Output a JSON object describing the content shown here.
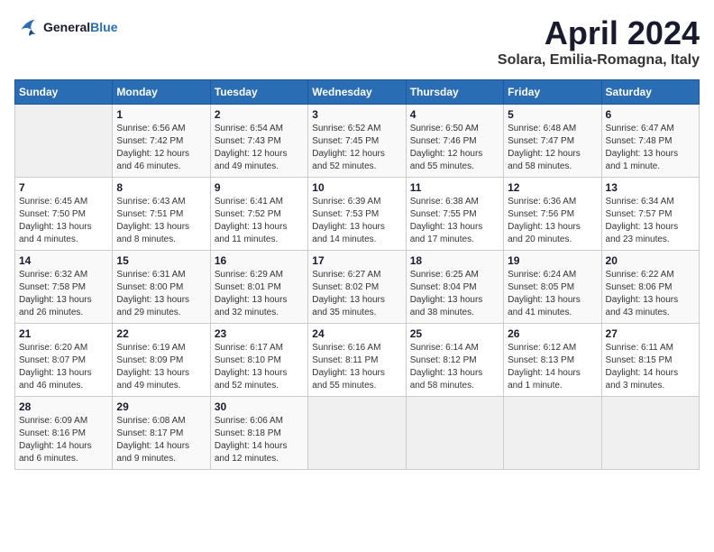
{
  "logo": {
    "line1": "General",
    "line2": "Blue"
  },
  "title": "April 2024",
  "location": "Solara, Emilia-Romagna, Italy",
  "headers": [
    "Sunday",
    "Monday",
    "Tuesday",
    "Wednesday",
    "Thursday",
    "Friday",
    "Saturday"
  ],
  "weeks": [
    [
      {
        "day": "",
        "info": ""
      },
      {
        "day": "1",
        "info": "Sunrise: 6:56 AM\nSunset: 7:42 PM\nDaylight: 12 hours\nand 46 minutes."
      },
      {
        "day": "2",
        "info": "Sunrise: 6:54 AM\nSunset: 7:43 PM\nDaylight: 12 hours\nand 49 minutes."
      },
      {
        "day": "3",
        "info": "Sunrise: 6:52 AM\nSunset: 7:45 PM\nDaylight: 12 hours\nand 52 minutes."
      },
      {
        "day": "4",
        "info": "Sunrise: 6:50 AM\nSunset: 7:46 PM\nDaylight: 12 hours\nand 55 minutes."
      },
      {
        "day": "5",
        "info": "Sunrise: 6:48 AM\nSunset: 7:47 PM\nDaylight: 12 hours\nand 58 minutes."
      },
      {
        "day": "6",
        "info": "Sunrise: 6:47 AM\nSunset: 7:48 PM\nDaylight: 13 hours\nand 1 minute."
      }
    ],
    [
      {
        "day": "7",
        "info": "Sunrise: 6:45 AM\nSunset: 7:50 PM\nDaylight: 13 hours\nand 4 minutes."
      },
      {
        "day": "8",
        "info": "Sunrise: 6:43 AM\nSunset: 7:51 PM\nDaylight: 13 hours\nand 8 minutes."
      },
      {
        "day": "9",
        "info": "Sunrise: 6:41 AM\nSunset: 7:52 PM\nDaylight: 13 hours\nand 11 minutes."
      },
      {
        "day": "10",
        "info": "Sunrise: 6:39 AM\nSunset: 7:53 PM\nDaylight: 13 hours\nand 14 minutes."
      },
      {
        "day": "11",
        "info": "Sunrise: 6:38 AM\nSunset: 7:55 PM\nDaylight: 13 hours\nand 17 minutes."
      },
      {
        "day": "12",
        "info": "Sunrise: 6:36 AM\nSunset: 7:56 PM\nDaylight: 13 hours\nand 20 minutes."
      },
      {
        "day": "13",
        "info": "Sunrise: 6:34 AM\nSunset: 7:57 PM\nDaylight: 13 hours\nand 23 minutes."
      }
    ],
    [
      {
        "day": "14",
        "info": "Sunrise: 6:32 AM\nSunset: 7:58 PM\nDaylight: 13 hours\nand 26 minutes."
      },
      {
        "day": "15",
        "info": "Sunrise: 6:31 AM\nSunset: 8:00 PM\nDaylight: 13 hours\nand 29 minutes."
      },
      {
        "day": "16",
        "info": "Sunrise: 6:29 AM\nSunset: 8:01 PM\nDaylight: 13 hours\nand 32 minutes."
      },
      {
        "day": "17",
        "info": "Sunrise: 6:27 AM\nSunset: 8:02 PM\nDaylight: 13 hours\nand 35 minutes."
      },
      {
        "day": "18",
        "info": "Sunrise: 6:25 AM\nSunset: 8:04 PM\nDaylight: 13 hours\nand 38 minutes."
      },
      {
        "day": "19",
        "info": "Sunrise: 6:24 AM\nSunset: 8:05 PM\nDaylight: 13 hours\nand 41 minutes."
      },
      {
        "day": "20",
        "info": "Sunrise: 6:22 AM\nSunset: 8:06 PM\nDaylight: 13 hours\nand 43 minutes."
      }
    ],
    [
      {
        "day": "21",
        "info": "Sunrise: 6:20 AM\nSunset: 8:07 PM\nDaylight: 13 hours\nand 46 minutes."
      },
      {
        "day": "22",
        "info": "Sunrise: 6:19 AM\nSunset: 8:09 PM\nDaylight: 13 hours\nand 49 minutes."
      },
      {
        "day": "23",
        "info": "Sunrise: 6:17 AM\nSunset: 8:10 PM\nDaylight: 13 hours\nand 52 minutes."
      },
      {
        "day": "24",
        "info": "Sunrise: 6:16 AM\nSunset: 8:11 PM\nDaylight: 13 hours\nand 55 minutes."
      },
      {
        "day": "25",
        "info": "Sunrise: 6:14 AM\nSunset: 8:12 PM\nDaylight: 13 hours\nand 58 minutes."
      },
      {
        "day": "26",
        "info": "Sunrise: 6:12 AM\nSunset: 8:13 PM\nDaylight: 14 hours\nand 1 minute."
      },
      {
        "day": "27",
        "info": "Sunrise: 6:11 AM\nSunset: 8:15 PM\nDaylight: 14 hours\nand 3 minutes."
      }
    ],
    [
      {
        "day": "28",
        "info": "Sunrise: 6:09 AM\nSunset: 8:16 PM\nDaylight: 14 hours\nand 6 minutes."
      },
      {
        "day": "29",
        "info": "Sunrise: 6:08 AM\nSunset: 8:17 PM\nDaylight: 14 hours\nand 9 minutes."
      },
      {
        "day": "30",
        "info": "Sunrise: 6:06 AM\nSunset: 8:18 PM\nDaylight: 14 hours\nand 12 minutes."
      },
      {
        "day": "",
        "info": ""
      },
      {
        "day": "",
        "info": ""
      },
      {
        "day": "",
        "info": ""
      },
      {
        "day": "",
        "info": ""
      }
    ]
  ]
}
